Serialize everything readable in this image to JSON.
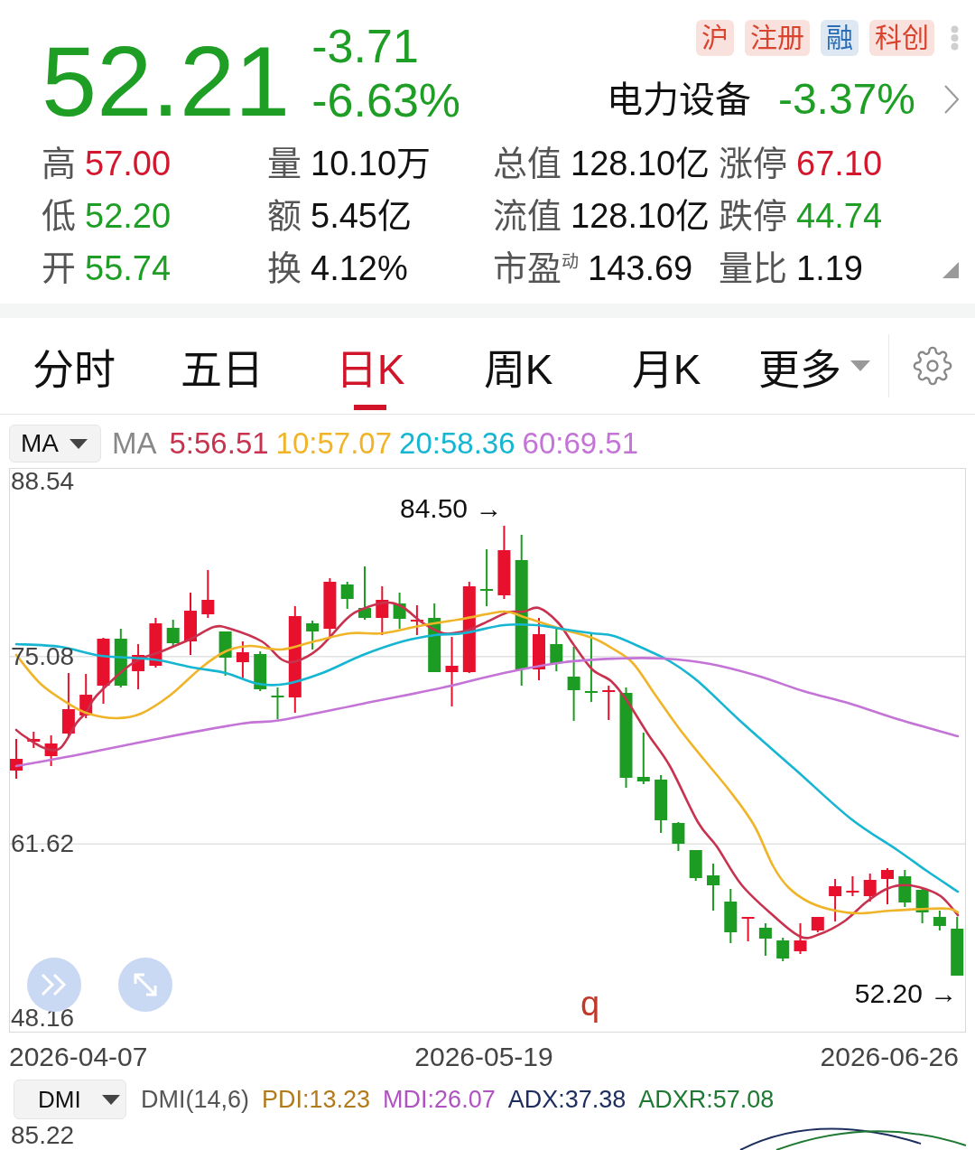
{
  "quote": {
    "price": "52.21",
    "change": "-3.71",
    "change_percent": "-6.63%",
    "falling": true
  },
  "tags": [
    {
      "label": "沪",
      "color": "#d9442f"
    },
    {
      "label": "注册",
      "color": "#d9442f"
    },
    {
      "label": "融",
      "color": "#2a6db5"
    },
    {
      "label": "科创",
      "color": "#d9442f"
    }
  ],
  "sector": {
    "name": "电力设备",
    "change": "-3.37%",
    "falling": true
  },
  "stats": [
    {
      "label": "高",
      "value": "57.00",
      "color": "#d3172e"
    },
    {
      "label": "量",
      "value": "10.10万",
      "color": "#111111"
    },
    {
      "label": "总值",
      "value": "128.10亿",
      "color": "#111111"
    },
    {
      "label": "涨停",
      "value": "67.10",
      "color": "#d3172e"
    },
    {
      "label": "低",
      "value": "52.20",
      "color": "#1f9e26"
    },
    {
      "label": "额",
      "value": "5.45亿",
      "color": "#111111"
    },
    {
      "label": "流值",
      "value": "128.10亿",
      "color": "#111111"
    },
    {
      "label": "跌停",
      "value": "44.74",
      "color": "#1f9e26"
    },
    {
      "label": "开",
      "value": "55.74",
      "color": "#1f9e26"
    },
    {
      "label": "换",
      "value": "4.12%",
      "color": "#111111"
    },
    {
      "label": "市盈$^{动}$",
      "value": "143.69",
      "color": "#111111"
    },
    {
      "label": "量比",
      "value": "1.19",
      "color": "#111111"
    }
  ],
  "period_tabs": [
    {
      "label": "分时",
      "selected": false,
      "kind": "tab"
    },
    {
      "label": "五日",
      "selected": false,
      "kind": "tab"
    },
    {
      "label": "日K",
      "selected": true,
      "kind": "tab"
    },
    {
      "label": "周K",
      "selected": false,
      "kind": "tab"
    },
    {
      "label": "月K",
      "selected": false,
      "kind": "tab"
    },
    {
      "label": "更多",
      "selected": false,
      "kind": "dropdown"
    }
  ],
  "ma_bar": {
    "selector": "MA",
    "label": "MA",
    "values": [
      {
        "text": "5:56.51",
        "color": "#c8324e"
      },
      {
        "text": "10:57.07",
        "color": "#f0b428"
      },
      {
        "text": "20:58.36",
        "color": "#16b6d2"
      },
      {
        "text": "60:69.51",
        "color": "#c474d6"
      }
    ]
  },
  "chart": {
    "y_labels": [
      "88.54",
      "75.08",
      "61.62",
      "48.16"
    ],
    "annotations": [
      {
        "text": "84.50 →",
        "kind": "high"
      },
      {
        "text": "52.20 →",
        "kind": "low"
      }
    ],
    "marker_text": "q",
    "x_labels": [
      "2026-04-07",
      "2026-05-19",
      "2026-06-26"
    ]
  },
  "dmi_bar": {
    "selector": "DMI",
    "label": "DMI(14,6)",
    "values": [
      {
        "text": "PDI:13.23",
        "color": "#b27a1a"
      },
      {
        "text": "MDI:26.07",
        "color": "#b052c2"
      },
      {
        "text": "ADX:37.38",
        "color": "#1d2d5e"
      },
      {
        "text": "ADXR:57.08",
        "color": "#1e7a32"
      }
    ]
  },
  "dmi_panel": {
    "y_label": "85.22"
  }
}
